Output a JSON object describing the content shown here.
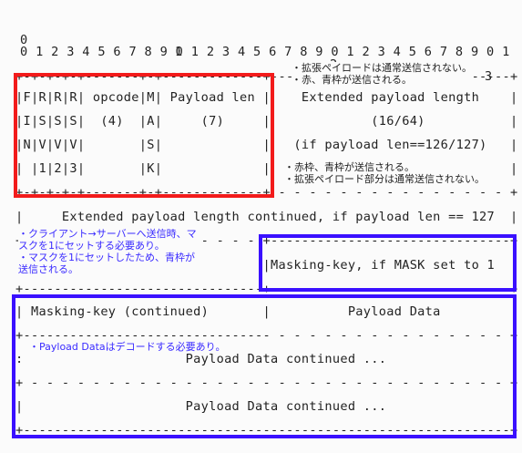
{
  "header": {
    "tens": [
      "0",
      "1",
      "2",
      "3"
    ],
    "units": "0 1 2 3 4 5 6 7 8 9 0 1 2 3 4 5 6 7 8 9 0 1 2 3 4 5 6 7 8 9 0 1"
  },
  "lines": {
    "border_top": "+-+-+-+-+-------+-+-------------+-------------------------------+",
    "row1": "|F|R|R|R| opcode|M| Payload len |    Extended payload length    |",
    "row2": "|I|S|S|S|  (4)  |A|     (7)     |             (16/64)           |",
    "row3": "|N|V|V|V|       |S|             |   (if payload len==126/127)   |",
    "row4": "| |1|2|3|       |K|             |                               |",
    "border_mid1": "+-+-+-+-+-------+-+-------------+ - - - - - - - - - - - - - - - +",
    "row5": "|     Extended payload length continued, if payload len == 127  |",
    "border_mid2": "+ - - - - - - - - - - - - - - - +-------------------------------+",
    "row6": "|                               |Masking-key, if MASK set to 1  |",
    "border_mid3": "+-------------------------------+-------------------------------+",
    "row7": "| Masking-key (continued)       |          Payload Data         |",
    "border_mid4": "+-------------------------------- - - - - - - - - - - - - - - - +",
    "row8": ":                     Payload Data continued ...                :",
    "border_mid5": "+ - - - - - - - - - - - - - - - - - - - - - - - - - - - - - - - +",
    "row9": "|                     Payload Data continued ...                |",
    "border_bottom": "+---------------------------------------------------------------+"
  },
  "annotations": {
    "note1": "・拡張ペイロードは通常送信されない。\n・赤、青枠が送信される。",
    "note2": "・赤枠、青枠が送信される。\n・拡張ペイロード部分は通常送信されない。",
    "note3": "・クライアント→サーバーへ送信時、マ\nスクを1にセットする必要あり。\n・マスクを1にセットしたため、青枠が\n送信される。",
    "note4": "・Payload Dataはデコードする必要あり。"
  },
  "colors": {
    "red": "#f21b1b",
    "blue": "#3a10ff",
    "note_blue": "#3a2bff",
    "text": "#222222"
  }
}
